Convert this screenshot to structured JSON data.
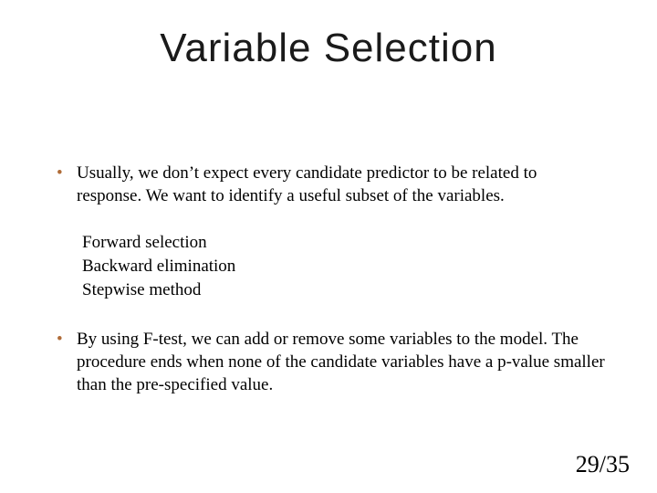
{
  "slide": {
    "title": "Variable Selection",
    "bullets": [
      "Usually, we don’t expect every candidate predictor to be related to response. We want to identify a useful subset of the variables.",
      "By using F-test, we can add or remove some variables to the model. The procedure ends when none of the candidate variables have a p-value smaller than the pre-specified value."
    ],
    "methods": [
      "Forward selection",
      "Backward elimination",
      "Stepwise method"
    ],
    "page": {
      "current": "29",
      "total": "35",
      "sep": "/"
    }
  }
}
